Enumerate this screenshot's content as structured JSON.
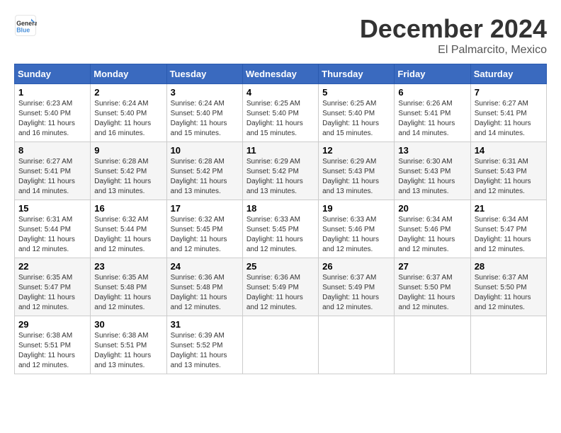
{
  "logo": {
    "general": "General",
    "blue": "Blue"
  },
  "title": "December 2024",
  "location": "El Palmarcito, Mexico",
  "days_header": [
    "Sunday",
    "Monday",
    "Tuesday",
    "Wednesday",
    "Thursday",
    "Friday",
    "Saturday"
  ],
  "weeks": [
    [
      {
        "day": "1",
        "info": "Sunrise: 6:23 AM\nSunset: 5:40 PM\nDaylight: 11 hours and 16 minutes."
      },
      {
        "day": "2",
        "info": "Sunrise: 6:24 AM\nSunset: 5:40 PM\nDaylight: 11 hours and 16 minutes."
      },
      {
        "day": "3",
        "info": "Sunrise: 6:24 AM\nSunset: 5:40 PM\nDaylight: 11 hours and 15 minutes."
      },
      {
        "day": "4",
        "info": "Sunrise: 6:25 AM\nSunset: 5:40 PM\nDaylight: 11 hours and 15 minutes."
      },
      {
        "day": "5",
        "info": "Sunrise: 6:25 AM\nSunset: 5:40 PM\nDaylight: 11 hours and 15 minutes."
      },
      {
        "day": "6",
        "info": "Sunrise: 6:26 AM\nSunset: 5:41 PM\nDaylight: 11 hours and 14 minutes."
      },
      {
        "day": "7",
        "info": "Sunrise: 6:27 AM\nSunset: 5:41 PM\nDaylight: 11 hours and 14 minutes."
      }
    ],
    [
      {
        "day": "8",
        "info": "Sunrise: 6:27 AM\nSunset: 5:41 PM\nDaylight: 11 hours and 14 minutes."
      },
      {
        "day": "9",
        "info": "Sunrise: 6:28 AM\nSunset: 5:42 PM\nDaylight: 11 hours and 13 minutes."
      },
      {
        "day": "10",
        "info": "Sunrise: 6:28 AM\nSunset: 5:42 PM\nDaylight: 11 hours and 13 minutes."
      },
      {
        "day": "11",
        "info": "Sunrise: 6:29 AM\nSunset: 5:42 PM\nDaylight: 11 hours and 13 minutes."
      },
      {
        "day": "12",
        "info": "Sunrise: 6:29 AM\nSunset: 5:43 PM\nDaylight: 11 hours and 13 minutes."
      },
      {
        "day": "13",
        "info": "Sunrise: 6:30 AM\nSunset: 5:43 PM\nDaylight: 11 hours and 13 minutes."
      },
      {
        "day": "14",
        "info": "Sunrise: 6:31 AM\nSunset: 5:43 PM\nDaylight: 11 hours and 12 minutes."
      }
    ],
    [
      {
        "day": "15",
        "info": "Sunrise: 6:31 AM\nSunset: 5:44 PM\nDaylight: 11 hours and 12 minutes."
      },
      {
        "day": "16",
        "info": "Sunrise: 6:32 AM\nSunset: 5:44 PM\nDaylight: 11 hours and 12 minutes."
      },
      {
        "day": "17",
        "info": "Sunrise: 6:32 AM\nSunset: 5:45 PM\nDaylight: 11 hours and 12 minutes."
      },
      {
        "day": "18",
        "info": "Sunrise: 6:33 AM\nSunset: 5:45 PM\nDaylight: 11 hours and 12 minutes."
      },
      {
        "day": "19",
        "info": "Sunrise: 6:33 AM\nSunset: 5:46 PM\nDaylight: 11 hours and 12 minutes."
      },
      {
        "day": "20",
        "info": "Sunrise: 6:34 AM\nSunset: 5:46 PM\nDaylight: 11 hours and 12 minutes."
      },
      {
        "day": "21",
        "info": "Sunrise: 6:34 AM\nSunset: 5:47 PM\nDaylight: 11 hours and 12 minutes."
      }
    ],
    [
      {
        "day": "22",
        "info": "Sunrise: 6:35 AM\nSunset: 5:47 PM\nDaylight: 11 hours and 12 minutes."
      },
      {
        "day": "23",
        "info": "Sunrise: 6:35 AM\nSunset: 5:48 PM\nDaylight: 11 hours and 12 minutes."
      },
      {
        "day": "24",
        "info": "Sunrise: 6:36 AM\nSunset: 5:48 PM\nDaylight: 11 hours and 12 minutes."
      },
      {
        "day": "25",
        "info": "Sunrise: 6:36 AM\nSunset: 5:49 PM\nDaylight: 11 hours and 12 minutes."
      },
      {
        "day": "26",
        "info": "Sunrise: 6:37 AM\nSunset: 5:49 PM\nDaylight: 11 hours and 12 minutes."
      },
      {
        "day": "27",
        "info": "Sunrise: 6:37 AM\nSunset: 5:50 PM\nDaylight: 11 hours and 12 minutes."
      },
      {
        "day": "28",
        "info": "Sunrise: 6:37 AM\nSunset: 5:50 PM\nDaylight: 11 hours and 12 minutes."
      }
    ],
    [
      {
        "day": "29",
        "info": "Sunrise: 6:38 AM\nSunset: 5:51 PM\nDaylight: 11 hours and 12 minutes."
      },
      {
        "day": "30",
        "info": "Sunrise: 6:38 AM\nSunset: 5:51 PM\nDaylight: 11 hours and 13 minutes."
      },
      {
        "day": "31",
        "info": "Sunrise: 6:39 AM\nSunset: 5:52 PM\nDaylight: 11 hours and 13 minutes."
      },
      null,
      null,
      null,
      null
    ]
  ]
}
